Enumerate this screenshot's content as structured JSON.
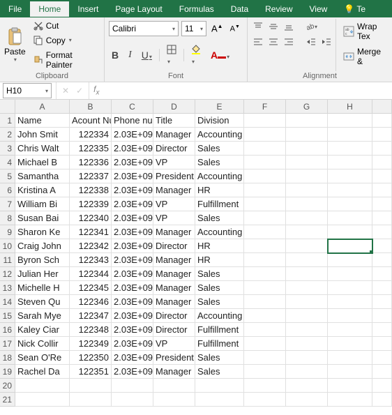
{
  "menu": {
    "file": "File",
    "home": "Home",
    "insert": "Insert",
    "pagelayout": "Page Layout",
    "formulas": "Formulas",
    "data": "Data",
    "review": "Review",
    "view": "View",
    "tell": "Te"
  },
  "ribbon": {
    "clipboard": {
      "label": "Clipboard",
      "paste": "Paste",
      "cut": "Cut",
      "copy": "Copy",
      "format_painter": "Format Painter"
    },
    "font": {
      "label": "Font",
      "name": "Calibri",
      "size": "11"
    },
    "alignment": {
      "label": "Alignment",
      "wrap": "Wrap Tex",
      "merge": "Merge &"
    }
  },
  "namebox": "H10",
  "chart_data": {
    "type": "table",
    "columns": [
      "A",
      "B",
      "C",
      "D",
      "E",
      "F",
      "G",
      "H",
      ""
    ],
    "headers": [
      "Name",
      "Acount Nu",
      "Phone nu",
      "Title",
      "Division",
      "",
      "",
      "",
      ""
    ],
    "rows": [
      [
        "John Smit",
        "122334",
        "2.03E+09",
        "Manager",
        "Accounting",
        "",
        "",
        "",
        ""
      ],
      [
        "Chris Walt",
        "122335",
        "2.03E+09",
        "Director",
        "Sales",
        "",
        "",
        "",
        ""
      ],
      [
        "Michael B",
        "122336",
        "2.03E+09",
        "VP",
        "Sales",
        "",
        "",
        "",
        ""
      ],
      [
        "Samantha",
        "122337",
        "2.03E+09",
        "President",
        "Accounting",
        "",
        "",
        "",
        ""
      ],
      [
        "Kristina A",
        "122338",
        "2.03E+09",
        "Manager",
        "HR",
        "",
        "",
        "",
        ""
      ],
      [
        "William Bi",
        "122339",
        "2.03E+09",
        "VP",
        "Fulfillment",
        "",
        "",
        "",
        ""
      ],
      [
        "Susan Bai",
        "122340",
        "2.03E+09",
        "VP",
        "Sales",
        "",
        "",
        "",
        ""
      ],
      [
        "Sharon Ke",
        "122341",
        "2.03E+09",
        "Manager",
        "Accounting",
        "",
        "",
        "",
        ""
      ],
      [
        "Craig John",
        "122342",
        "2.03E+09",
        "Director",
        "HR",
        "",
        "",
        "",
        ""
      ],
      [
        "Byron Sch",
        "122343",
        "2.03E+09",
        "Manager",
        "HR",
        "",
        "",
        "",
        ""
      ],
      [
        "Julian Her",
        "122344",
        "2.03E+09",
        "Manager",
        "Sales",
        "",
        "",
        "",
        ""
      ],
      [
        "Michelle H",
        "122345",
        "2.03E+09",
        "Manager",
        "Sales",
        "",
        "",
        "",
        ""
      ],
      [
        "Steven Qu",
        "122346",
        "2.03E+09",
        "Manager",
        "Sales",
        "",
        "",
        "",
        ""
      ],
      [
        "Sarah Mye",
        "122347",
        "2.03E+09",
        "Director",
        "Accounting",
        "",
        "",
        "",
        ""
      ],
      [
        "Kaley Ciar",
        "122348",
        "2.03E+09",
        "Director",
        "Fulfillment",
        "",
        "",
        "",
        ""
      ],
      [
        "Nick Collir",
        "122349",
        "2.03E+09",
        "VP",
        "Fulfillment",
        "",
        "",
        "",
        ""
      ],
      [
        "Sean O'Re",
        "122350",
        "2.03E+09",
        "President",
        "Sales",
        "",
        "",
        "",
        ""
      ],
      [
        "Rachel Da",
        "122351",
        "2.03E+09",
        "Manager",
        "Sales",
        "",
        "",
        "",
        ""
      ],
      [
        "",
        "",
        "",
        "",
        "",
        "",
        "",
        "",
        ""
      ],
      [
        "",
        "",
        "",
        "",
        "",
        "",
        "",
        "",
        ""
      ]
    ],
    "selected_cell": "H10",
    "numeric_columns": [
      1,
      2
    ]
  }
}
